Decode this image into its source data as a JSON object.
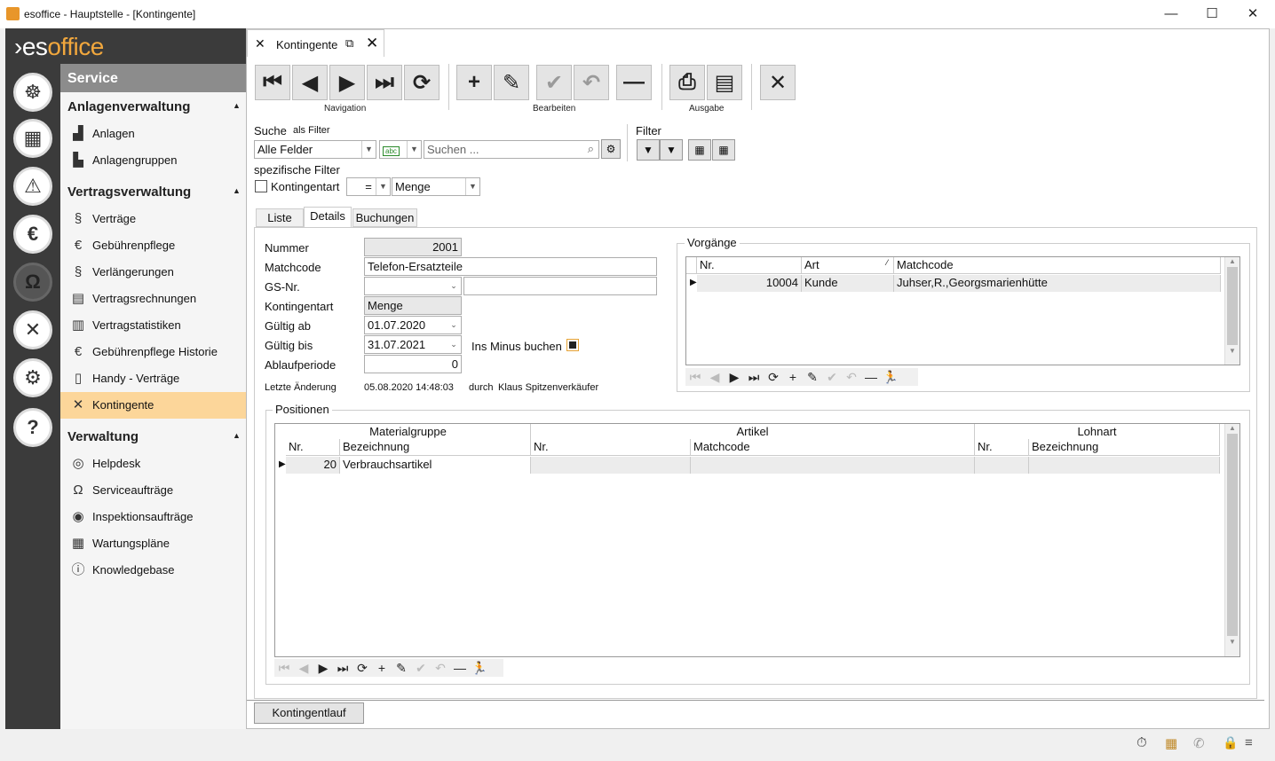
{
  "window": {
    "title": "esoffice - Hauptstelle - [Kontingente]",
    "minimize": "—",
    "maximize": "☐",
    "close": "✕"
  },
  "logo": {
    "prefix": "›es",
    "suffix": "office"
  },
  "rail": [
    {
      "icon": "helm-icon"
    },
    {
      "icon": "grid-icon"
    },
    {
      "icon": "alarm-icon"
    },
    {
      "icon": "money-icon"
    },
    {
      "icon": "headset-icon"
    },
    {
      "icon": "tools-icon"
    },
    {
      "icon": "gears-icon"
    },
    {
      "icon": "help-icon"
    }
  ],
  "nav": {
    "header": "Service",
    "groups": [
      {
        "title": "Anlagenverwaltung",
        "items": [
          "Anlagen",
          "Anlagengruppen"
        ]
      },
      {
        "title": "Vertragsverwaltung",
        "items": [
          "Verträge",
          "Gebührenpflege",
          "Verlängerungen",
          "Vertragsrechnungen",
          "Vertragstatistiken",
          "Gebührenpflege Historie",
          "Handy - Verträge",
          "Kontingente"
        ]
      },
      {
        "title": "Verwaltung",
        "items": [
          "Helpdesk",
          "Serviceaufträge",
          "Inspektionsaufträge",
          "Wartungspläne",
          "Knowledgebase"
        ]
      }
    ],
    "selected": "Kontingente"
  },
  "tab": {
    "label": "Kontingente"
  },
  "toolbar": {
    "navigation": "Navigation",
    "bearbeiten": "Bearbeiten",
    "ausgabe": "Ausgabe"
  },
  "search": {
    "label": "Suche",
    "as_filter": "als Filter",
    "field": "Alle Felder",
    "placeholder": "Suchen ...",
    "filter_label": "Filter"
  },
  "specific": {
    "label": "spezifische Filter",
    "checkbox": "Kontingentart",
    "op": "=",
    "value": "Menge"
  },
  "subtabs": [
    "Liste",
    "Details",
    "Buchungen"
  ],
  "form": {
    "nummer_label": "Nummer",
    "nummer": "2001",
    "matchcode_label": "Matchcode",
    "matchcode": "Telefon-Ersatzteile",
    "gs_label": "GS-Nr.",
    "gs": "",
    "gs2": "",
    "art_label": "Kontingentart",
    "art": "Menge",
    "ab_label": "Gültig ab",
    "ab": "01.07.2020",
    "bis_label": "Gültig bis",
    "bis": "31.07.2021",
    "minus_label": "Ins Minus buchen",
    "ablauf_label": "Ablaufperiode",
    "ablauf": "0",
    "change_label": "Letzte Änderung",
    "change_date": "05.08.2020 14:48:03",
    "durch": "durch",
    "user": "Klaus Spitzenverkäufer"
  },
  "vorgaenge": {
    "title": "Vorgänge",
    "headers": [
      "Nr.",
      "Art",
      "Matchcode"
    ],
    "rows": [
      [
        "10004",
        "Kunde",
        "Juhser,R.,Georgsmarienhütte"
      ]
    ]
  },
  "positionen": {
    "title": "Positionen",
    "groups": [
      "Materialgruppe",
      "Artikel",
      "Lohnart"
    ],
    "headers": [
      "Nr.",
      "Bezeichnung",
      "Nr.",
      "Matchcode",
      "Nr.",
      "Bezeichnung"
    ],
    "rows": [
      [
        "20",
        "Verbrauchsartikel",
        "",
        "",
        "",
        ""
      ]
    ]
  },
  "bottom": {
    "button": "Kontingentlauf"
  },
  "status": {
    "icons": [
      "stopwatch-icon",
      "building-icon",
      "phone-icon",
      "lock-icon",
      "database-icon"
    ]
  }
}
